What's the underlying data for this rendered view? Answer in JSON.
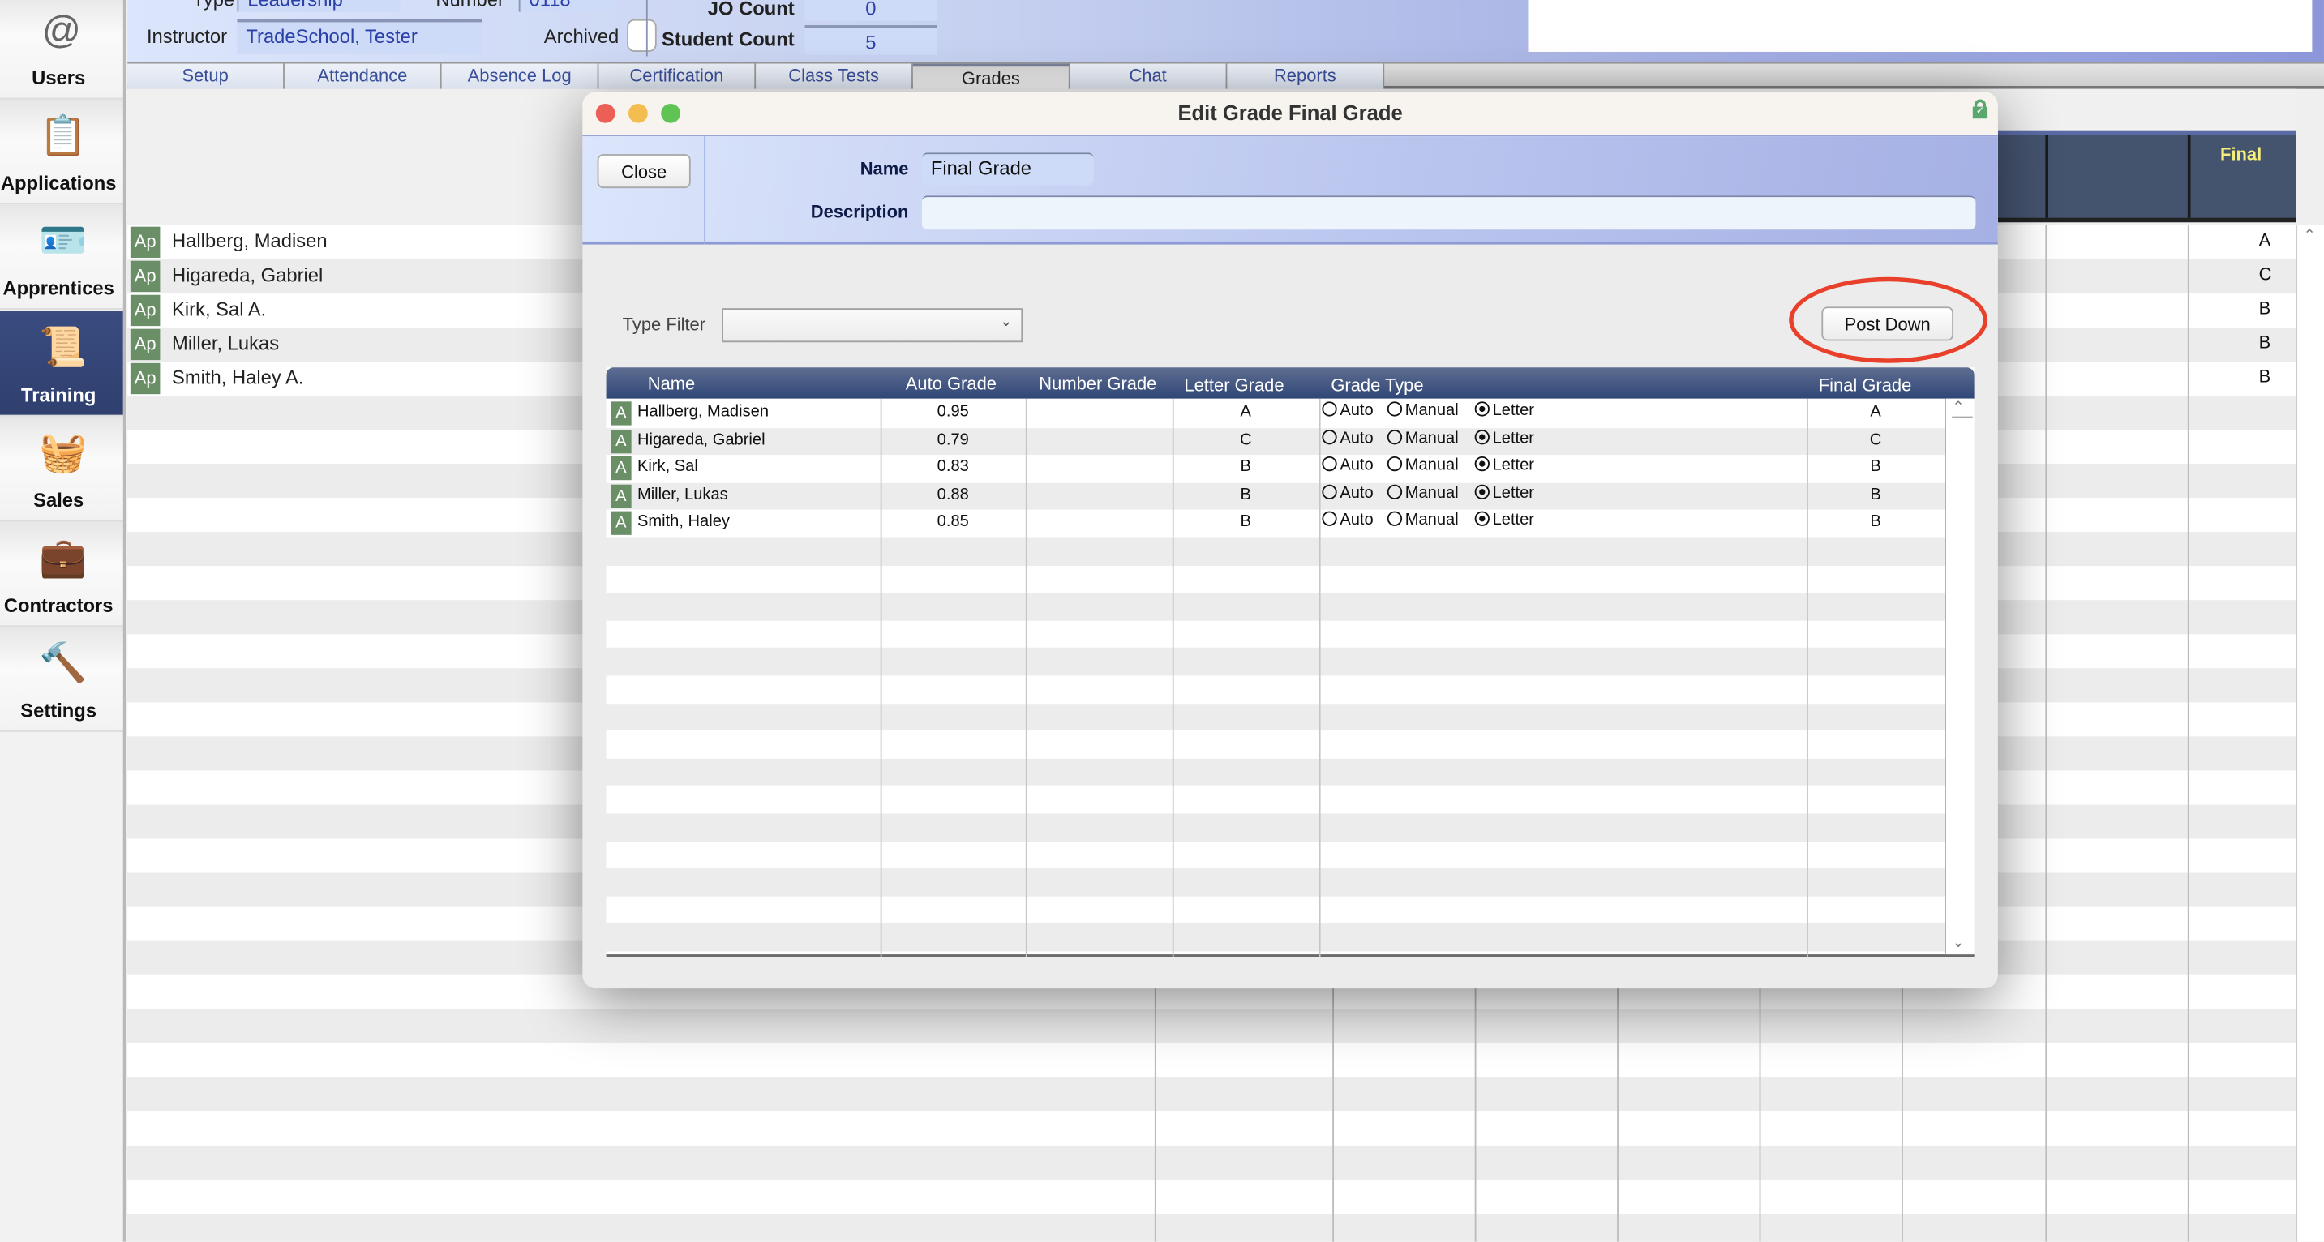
{
  "sidebar": {
    "items": [
      {
        "label": "Users",
        "icon": "users-at-icon"
      },
      {
        "label": "Applications",
        "icon": "clipboard-icon"
      },
      {
        "label": "Apprentices",
        "icon": "id-badge-icon"
      },
      {
        "label": "Training",
        "icon": "certificate-icon",
        "selected": true
      },
      {
        "label": "Sales",
        "icon": "basket-icon"
      },
      {
        "label": "Contractors",
        "icon": "briefcase-icon"
      },
      {
        "label": "Settings",
        "icon": "hammer-globe-icon"
      }
    ]
  },
  "header": {
    "type_label": "Type",
    "type_value": "Leadership",
    "number_label": "Number",
    "number_value": "0118",
    "instructor_label": "Instructor",
    "instructor_value": "TradeSchool, Tester",
    "archived_label": "Archived",
    "jo_count_label": "JO Count",
    "jo_count_value": "0",
    "student_count_label": "Student Count",
    "student_count_value": "5"
  },
  "tabs": [
    {
      "label": "Setup"
    },
    {
      "label": "Attendance"
    },
    {
      "label": "Absence Log"
    },
    {
      "label": "Certification"
    },
    {
      "label": "Class Tests"
    },
    {
      "label": "Grades",
      "selected": true
    },
    {
      "label": "Chat"
    },
    {
      "label": "Reports"
    }
  ],
  "background_list": {
    "final_header": "Final",
    "rows": [
      {
        "badge": "Ap",
        "name": "Hallberg, Madisen",
        "final": "A"
      },
      {
        "badge": "Ap",
        "name": "Higareda, Gabriel",
        "final": "C"
      },
      {
        "badge": "Ap",
        "name": "Kirk, Sal  A.",
        "final": "B"
      },
      {
        "badge": "Ap",
        "name": "Miller, Lukas",
        "final": "B"
      },
      {
        "badge": "Ap",
        "name": "Smith, Haley  A.",
        "final": "B"
      }
    ]
  },
  "modal": {
    "title": "Edit Grade Final Grade",
    "close_label": "Close",
    "name_label": "Name",
    "name_value": "Final Grade",
    "description_label": "Description",
    "description_value": "",
    "type_filter_label": "Type Filter",
    "type_filter_value": "",
    "post_down_label": "Post Down",
    "highlight_color": "#e8402a",
    "columns": [
      "Name",
      "Auto Grade",
      "Number Grade",
      "Letter Grade",
      "Grade Type",
      "Final Grade"
    ],
    "grade_type_options": [
      "Auto",
      "Manual",
      "Letter"
    ],
    "rows": [
      {
        "badge": "A",
        "name": "Hallberg, Madisen",
        "auto": "0.95",
        "number": "",
        "letter": "A",
        "grade_type": "Letter",
        "final": "A"
      },
      {
        "badge": "A",
        "name": "Higareda, Gabriel",
        "auto": "0.79",
        "number": "",
        "letter": "C",
        "grade_type": "Letter",
        "final": "C"
      },
      {
        "badge": "A",
        "name": "Kirk, Sal",
        "auto": "0.83",
        "number": "",
        "letter": "B",
        "grade_type": "Letter",
        "final": "B"
      },
      {
        "badge": "A",
        "name": "Miller, Lukas",
        "auto": "0.88",
        "number": "",
        "letter": "B",
        "grade_type": "Letter",
        "final": "B"
      },
      {
        "badge": "A",
        "name": "Smith, Haley",
        "auto": "0.85",
        "number": "",
        "letter": "B",
        "grade_type": "Letter",
        "final": "B"
      }
    ]
  }
}
